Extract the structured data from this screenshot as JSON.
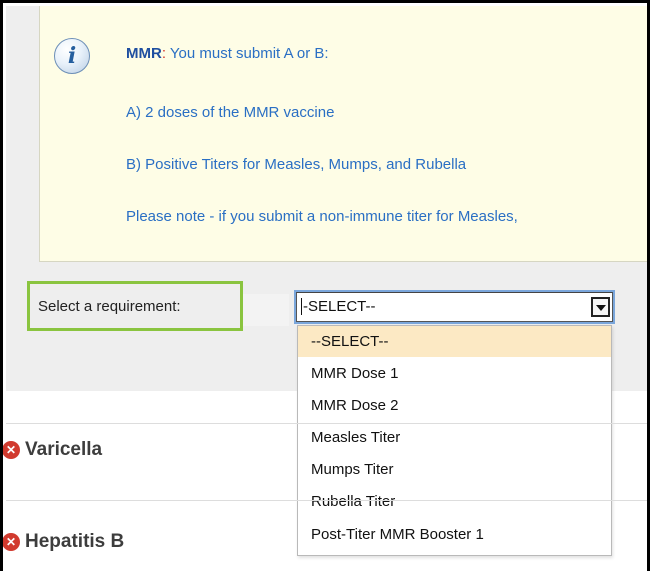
{
  "info": {
    "title_bold": "MMR",
    "title_colon": ":",
    "title_rest": " You must submit A or B:",
    "line_a": "A) 2 doses of the MMR vaccine",
    "line_b": "B) Positive Titers for Measles, Mumps, and Rubella",
    "note": "Please note - if you submit a non-immune titer for Measles,",
    "icon": "info-icon"
  },
  "requirement": {
    "label": "Select a requirement:",
    "selected_value": "-SELECT--",
    "options": [
      "--SELECT--",
      "MMR Dose 1",
      "MMR Dose 2",
      "Measles Titer",
      "Mumps Titer",
      "Rubella Titer",
      "Post-Titer MMR Booster 1"
    ]
  },
  "sections": [
    {
      "title": "Varicella",
      "icon": "error-x-icon"
    },
    {
      "title": "Hepatitis B",
      "icon": "error-x-icon"
    }
  ],
  "colors": {
    "highlight": "#8ac43f",
    "info_bg": "#fefde6",
    "link_blue": "#2a6fc4",
    "error_red": "#d13a2e",
    "selected_option": "#fce9c4"
  }
}
